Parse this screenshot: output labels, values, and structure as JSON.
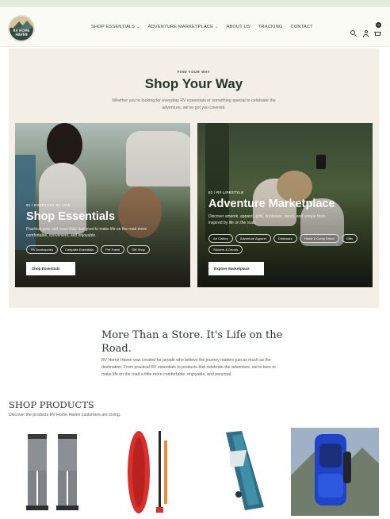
{
  "header": {
    "logo_text": "RV HOME HAVEN",
    "nav": [
      {
        "label": "SHOP ESSENTIALS",
        "dropdown": true
      },
      {
        "label": "ADVENTURE MARKETPLACE",
        "dropdown": true
      },
      {
        "label": "ABOUT US",
        "dropdown": false
      },
      {
        "label": "TRACKING",
        "dropdown": false
      },
      {
        "label": "CONTACT",
        "dropdown": false
      }
    ],
    "cart_count": "0",
    "icons": [
      "search-icon",
      "account-icon",
      "cart-icon"
    ]
  },
  "way": {
    "eyebrow": "FIND YOUR WAY",
    "title": "Shop Your Way",
    "subtitle": "Whether you're looking for everyday RV essentials or something special to celebrate the adventure, we've got you covered."
  },
  "cards": [
    {
      "eyebrow": "01 / EVERYDAY RV LIFE",
      "title": "Shop Essentials",
      "description": "Practical gear and essentials designed to make life on the road more comfortable, convenient, and enjoyable.",
      "tags": [
        "RV Accessories",
        "Campsite Essentials",
        "Pet Travel",
        "Gift Shop"
      ],
      "button": "Shop Essentials"
    },
    {
      "eyebrow": "02 / RV LIFESTYLE",
      "title": "Adventure Marketplace",
      "description": "Discover artwork, apparel, gifts, drinkware, decor, and unique finds inspired by life on the road.",
      "tags": [
        "Art Gallery",
        "Adventure Apparel",
        "Drinkware",
        "Home & Camp Décor",
        "Gifts",
        "Stickers & Decals"
      ],
      "button": "Explore Marketplace"
    }
  ],
  "story": {
    "title": "More Than a Store. It's Life on the Road.",
    "body": "RV Home Haven was created for people who believe the journey matters just as much as the destination. From practical RV essentials to products that celebrate the adventure, we're here to make life on the road a little more comfortable, enjoyable, and personal."
  },
  "products": {
    "title": "SHOP PRODUCTS",
    "subtitle": "Discover the products RV Home Haven customers are loving.",
    "items": [
      "waders",
      "paddle-board",
      "inflatable-kayak",
      "hiking-backpack"
    ]
  },
  "colors": {
    "accent": "#22372e",
    "section_bg": "#f3efe6",
    "header_bg": "#fbfbf6"
  }
}
